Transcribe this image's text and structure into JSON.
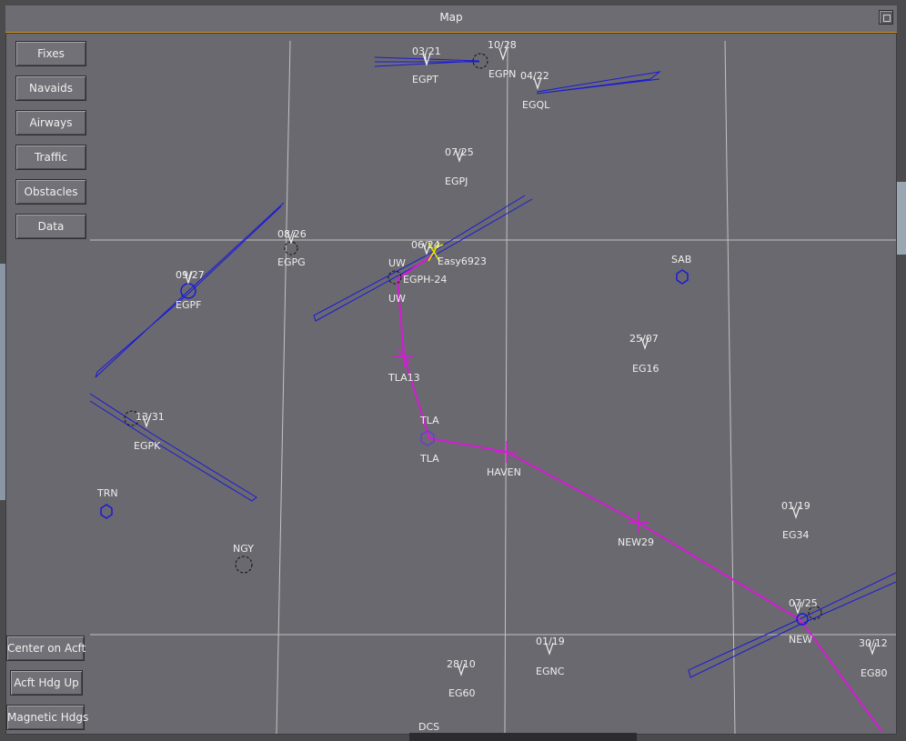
{
  "window": {
    "title": "Map"
  },
  "buttons_top": [
    "Fixes",
    "Navaids",
    "Airways",
    "Traffic",
    "Obstacles",
    "Data"
  ],
  "buttons_bottom": [
    "Center on Acft",
    "Acft Hdg Up",
    "Magnetic Hdgs"
  ],
  "colors": {
    "route": "#d61ad6",
    "runway_extension": "#1a1ad8",
    "grid": "#d9d9d9",
    "traffic": "#e8e800"
  },
  "airports": [
    {
      "id": "EGPT",
      "runway": "03/21"
    },
    {
      "id": "EGPN",
      "runway": "10/28"
    },
    {
      "id": "EGQL",
      "runway": "04/22"
    },
    {
      "id": "EGPJ",
      "runway": "07/25"
    },
    {
      "id": "EGPG",
      "runway": "08/26"
    },
    {
      "id": "EGPF",
      "runway": "09/27"
    },
    {
      "id": "EGPH-24",
      "runway": "06/24"
    },
    {
      "id": "EG16",
      "runway": "25/07"
    },
    {
      "id": "EGPK",
      "runway": "13/31"
    },
    {
      "id": "EG34",
      "runway": "01/19"
    },
    {
      "id": "NEW",
      "runway": "07/25"
    },
    {
      "id": "EGNC",
      "runway": "01/19"
    },
    {
      "id": "EG60",
      "runway": "28/10"
    },
    {
      "id": "EG80",
      "runway": "30/12"
    }
  ],
  "navaids": [
    "SAB",
    "TRN",
    "NGY",
    "TLA",
    "UW",
    "DCS"
  ],
  "route_waypoints": [
    "UW",
    "TLA13",
    "TLA",
    "HAVEN",
    "NEW29",
    "NEW"
  ],
  "traffic": {
    "callsign": "Easy6923"
  }
}
